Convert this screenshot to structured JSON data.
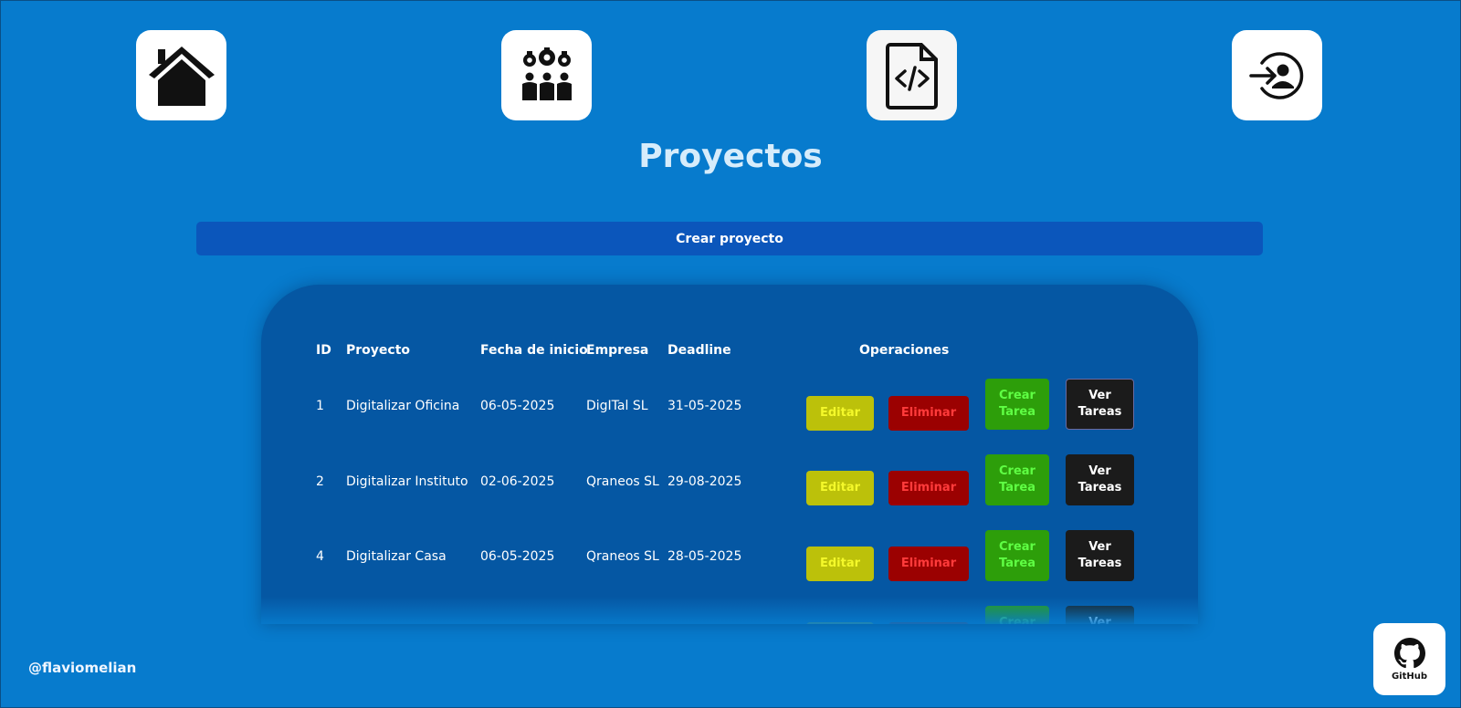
{
  "nav": {
    "items": [
      {
        "icon": "home-icon"
      },
      {
        "icon": "team-gears-icon"
      },
      {
        "icon": "code-file-icon"
      },
      {
        "icon": "login-user-icon"
      }
    ]
  },
  "page": {
    "title": "Proyectos"
  },
  "create_button": {
    "label": "Crear proyecto"
  },
  "table": {
    "headers": {
      "id": "ID",
      "project": "Proyecto",
      "start": "Fecha de inicio",
      "company": "Empresa",
      "deadline": "Deadline",
      "operations": "Operaciones"
    },
    "rows": [
      {
        "id": "1",
        "project": "Digitalizar Oficina",
        "start": "06-05-2025",
        "company": "DigITal SL",
        "deadline": "31-05-2025"
      },
      {
        "id": "2",
        "project": "Digitalizar Instituto",
        "start": "02-06-2025",
        "company": "Qraneos SL",
        "deadline": "29-08-2025"
      },
      {
        "id": "4",
        "project": "Digitalizar Casa",
        "start": "06-05-2025",
        "company": "Qraneos SL",
        "deadline": "28-05-2025"
      }
    ],
    "operations": {
      "edit": "Editar",
      "delete": "Eliminar",
      "create_task": "Crear Tarea",
      "view_tasks": "Ver Tareas"
    }
  },
  "footer": {
    "handle": "@flaviomelian",
    "github_label": "GitHub"
  },
  "colors": {
    "background": "#077bcd",
    "panel": "#0557a3",
    "create_button": "#0b56bb",
    "edit": "#bcc10a",
    "delete": "#9b0101",
    "create_task": "#2d9e0a",
    "view_tasks": "#1b1b1b"
  }
}
